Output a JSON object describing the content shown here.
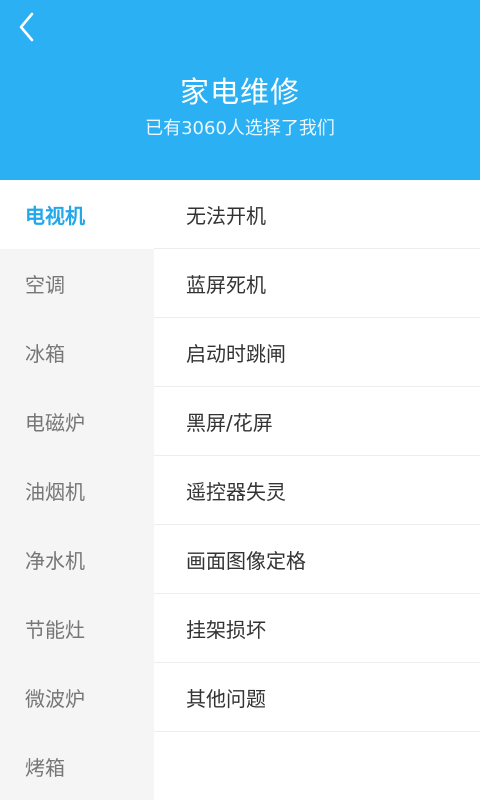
{
  "colors": {
    "header_background": "#2ab0f3",
    "active_category": "#22a8ea",
    "sidebar_background": "#f5f5f5",
    "text_primary": "#333333",
    "text_secondary": "#767676"
  },
  "header": {
    "back_icon": "chevron-left-icon",
    "title": "家电维修",
    "subtitle": "已有3060人选择了我们"
  },
  "categories": [
    {
      "label": "电视机",
      "selected": true
    },
    {
      "label": "空调",
      "selected": false
    },
    {
      "label": "冰箱",
      "selected": false
    },
    {
      "label": "电磁炉",
      "selected": false
    },
    {
      "label": "油烟机",
      "selected": false
    },
    {
      "label": "净水机",
      "selected": false
    },
    {
      "label": "节能灶",
      "selected": false
    },
    {
      "label": "微波炉",
      "selected": false
    },
    {
      "label": "烤箱",
      "selected": false
    }
  ],
  "problems": [
    {
      "label": "无法开机"
    },
    {
      "label": "蓝屏死机"
    },
    {
      "label": "启动时跳闸"
    },
    {
      "label": "黑屏/花屏"
    },
    {
      "label": "遥控器失灵"
    },
    {
      "label": "画面图像定格"
    },
    {
      "label": "挂架损坏"
    },
    {
      "label": "其他问题"
    }
  ]
}
